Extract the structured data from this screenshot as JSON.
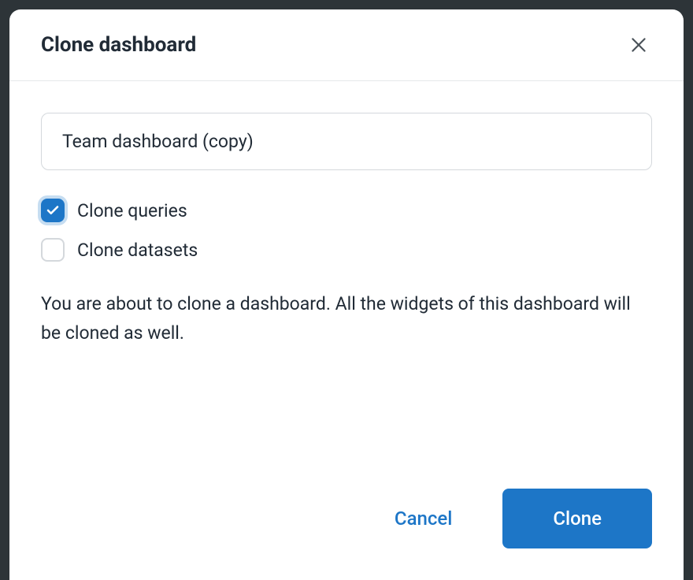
{
  "modal": {
    "title": "Clone dashboard",
    "input": {
      "value": "Team dashboard (copy)"
    },
    "checkboxes": [
      {
        "label": "Clone queries",
        "checked": true
      },
      {
        "label": "Clone datasets",
        "checked": false
      }
    ],
    "info_text": "You are about to clone a dashboard. All the widgets of this dashboard will be cloned as well.",
    "footer": {
      "cancel_label": "Cancel",
      "confirm_label": "Clone"
    }
  }
}
